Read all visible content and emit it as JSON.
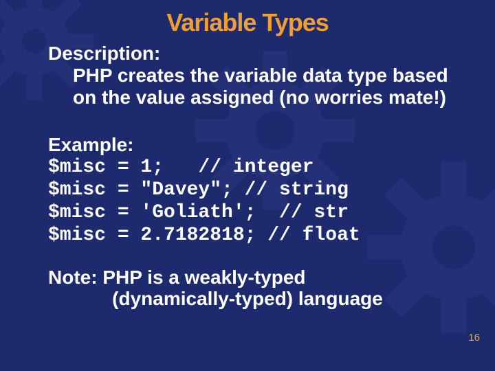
{
  "title": "Variable Types",
  "description_label": "Description:",
  "description_body": "PHP creates the variable data type based on the value assigned (no worries mate!)",
  "example_label": "Example:",
  "code_lines": [
    "$misc = 1;   // integer",
    "$misc = \"Davey\"; // string",
    "$misc = 'Goliath';  // str",
    "$misc = 2.7182818; // float"
  ],
  "note_line1": "Note: PHP is a weakly-typed",
  "note_line2": "(dynamically-typed) language",
  "page_number": "16"
}
